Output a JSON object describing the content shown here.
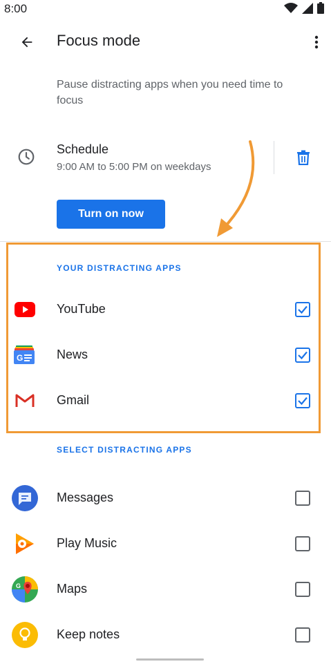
{
  "status_bar": {
    "time": "8:00"
  },
  "header": {
    "title": "Focus mode"
  },
  "description": "Pause distracting apps when you need time to focus",
  "schedule": {
    "title": "Schedule",
    "subtitle": "9:00 AM to 5:00 PM on weekdays"
  },
  "turn_on_button": {
    "label": "Turn on now"
  },
  "your_distracting_apps": {
    "header": "YOUR DISTRACTING APPS",
    "items": [
      {
        "label": "YouTube",
        "icon": "youtube-icon",
        "checked": true
      },
      {
        "label": "News",
        "icon": "news-icon",
        "checked": true
      },
      {
        "label": "Gmail",
        "icon": "gmail-icon",
        "checked": true
      }
    ]
  },
  "select_distracting_apps": {
    "header": "SELECT DISTRACTING APPS",
    "items": [
      {
        "label": "Messages",
        "icon": "messages-icon",
        "checked": false
      },
      {
        "label": "Play Music",
        "icon": "play-music-icon",
        "checked": false
      },
      {
        "label": "Maps",
        "icon": "maps-icon",
        "checked": false
      },
      {
        "label": "Keep notes",
        "icon": "keep-notes-icon",
        "checked": false
      }
    ]
  },
  "colors": {
    "accent": "#1a73e8",
    "annotation": "#f09a35",
    "text_primary": "#202124",
    "text_secondary": "#5f6368"
  }
}
